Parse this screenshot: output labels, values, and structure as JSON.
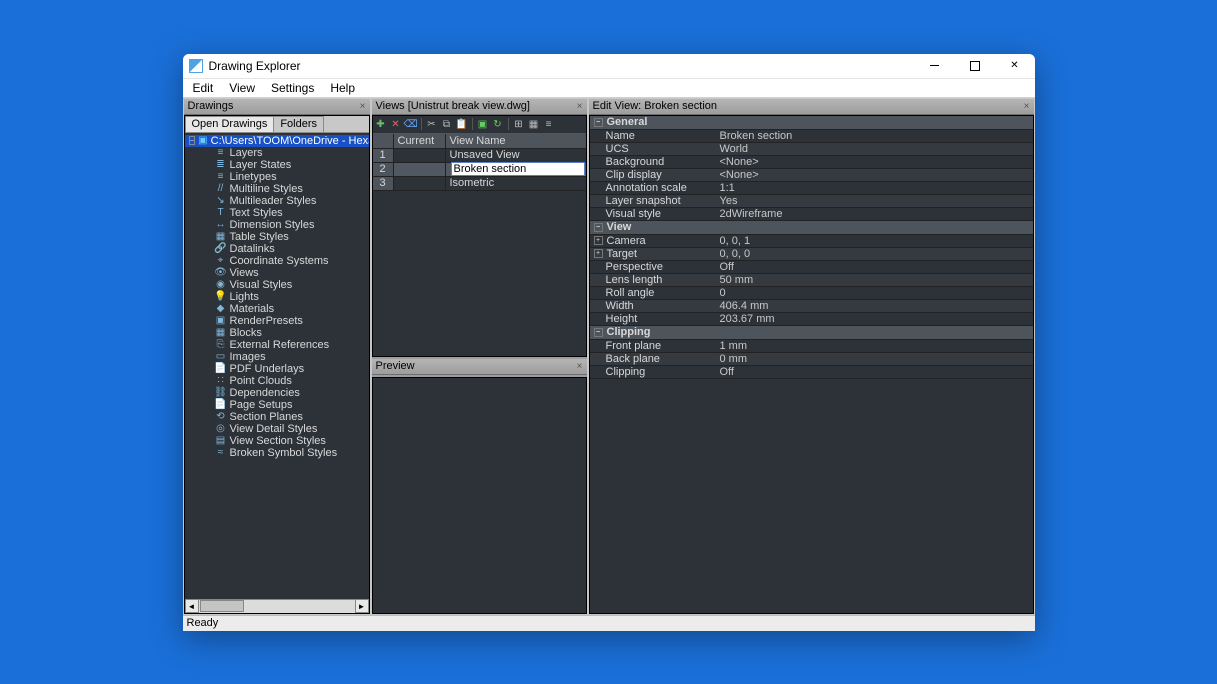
{
  "window": {
    "title": "Drawing Explorer",
    "menus": [
      "Edit",
      "View",
      "Settings",
      "Help"
    ],
    "status": "Ready"
  },
  "drawings_panel": {
    "title": "Drawings",
    "tabs": [
      "Open Drawings",
      "Folders"
    ],
    "active_tab_index": 0,
    "root": "C:\\Users\\TOOM\\OneDrive - Hexagon\\D",
    "nodes": [
      {
        "icon": "layers",
        "label": "Layers"
      },
      {
        "icon": "layer-states",
        "label": "Layer States"
      },
      {
        "icon": "linetypes",
        "label": "Linetypes"
      },
      {
        "icon": "mline",
        "label": "Multiline Styles"
      },
      {
        "icon": "mleader",
        "label": "Multileader Styles"
      },
      {
        "icon": "text",
        "label": "Text Styles"
      },
      {
        "icon": "dim",
        "label": "Dimension Styles"
      },
      {
        "icon": "table",
        "label": "Table Styles"
      },
      {
        "icon": "datalink",
        "label": "Datalinks"
      },
      {
        "icon": "coord",
        "label": "Coordinate Systems"
      },
      {
        "icon": "views",
        "label": "Views"
      },
      {
        "icon": "vstyle",
        "label": "Visual Styles"
      },
      {
        "icon": "lights",
        "label": "Lights"
      },
      {
        "icon": "materials",
        "label": "Materials"
      },
      {
        "icon": "render",
        "label": "RenderPresets"
      },
      {
        "icon": "blocks",
        "label": "Blocks"
      },
      {
        "icon": "xref",
        "label": "External References"
      },
      {
        "icon": "images",
        "label": "Images"
      },
      {
        "icon": "pdf",
        "label": "PDF Underlays"
      },
      {
        "icon": "pcloud",
        "label": "Point Clouds"
      },
      {
        "icon": "deps",
        "label": "Dependencies"
      },
      {
        "icon": "page",
        "label": "Page Setups"
      },
      {
        "icon": "section",
        "label": "Section Planes"
      },
      {
        "icon": "vdetail",
        "label": "View Detail Styles"
      },
      {
        "icon": "vsection",
        "label": "View Section Styles"
      },
      {
        "icon": "broken",
        "label": "Broken Symbol Styles"
      }
    ]
  },
  "views_panel": {
    "title": "Views [Unistrut break view.dwg]",
    "columns": [
      "",
      "Current",
      "View Name"
    ],
    "rows": [
      {
        "n": "1",
        "current": "",
        "name": "Unsaved View",
        "editing": false
      },
      {
        "n": "2",
        "current": "",
        "name": "Broken section",
        "editing": true
      },
      {
        "n": "3",
        "current": "",
        "name": "Isometric",
        "editing": false
      }
    ]
  },
  "preview_panel": {
    "title": "Preview"
  },
  "edit_panel": {
    "title": "Edit View: Broken section",
    "sections": [
      {
        "name": "General",
        "open": true,
        "props": [
          {
            "k": "Name",
            "v": "Broken section"
          },
          {
            "k": "UCS",
            "v": "World"
          },
          {
            "k": "Background",
            "v": "<None>"
          },
          {
            "k": "Clip display",
            "v": "<None>"
          },
          {
            "k": "Annotation scale",
            "v": "1:1"
          },
          {
            "k": "Layer snapshot",
            "v": "Yes"
          },
          {
            "k": "Visual style",
            "v": "2dWireframe"
          }
        ]
      },
      {
        "name": "View",
        "open": true,
        "props": [
          {
            "k": "Camera",
            "v": "0, 0, 1",
            "expandable": true
          },
          {
            "k": "Target",
            "v": "0, 0, 0",
            "expandable": true
          },
          {
            "k": "Perspective",
            "v": "Off"
          },
          {
            "k": "Lens length",
            "v": "50 mm"
          },
          {
            "k": "Roll angle",
            "v": "0"
          },
          {
            "k": "Width",
            "v": "406.4 mm"
          },
          {
            "k": "Height",
            "v": "203.67 mm"
          }
        ]
      },
      {
        "name": "Clipping",
        "open": true,
        "props": [
          {
            "k": "Front plane",
            "v": "1 mm"
          },
          {
            "k": "Back plane",
            "v": "0 mm"
          },
          {
            "k": "Clipping",
            "v": "Off"
          }
        ]
      }
    ]
  },
  "icon_glyph": {
    "layers": "≡",
    "layer-states": "≣",
    "linetypes": "≡",
    "mline": "//",
    "mleader": "↘",
    "text": "T",
    "dim": "↔",
    "table": "▦",
    "datalink": "🔗",
    "coord": "⌖",
    "views": "👁",
    "vstyle": "◉",
    "lights": "💡",
    "materials": "◆",
    "render": "▣",
    "blocks": "▦",
    "xref": "⎘",
    "images": "▭",
    "pdf": "📄",
    "pcloud": "∷",
    "deps": "⛓",
    "page": "📄",
    "section": "⟲",
    "vdetail": "◎",
    "vsection": "▤",
    "broken": "≈"
  }
}
